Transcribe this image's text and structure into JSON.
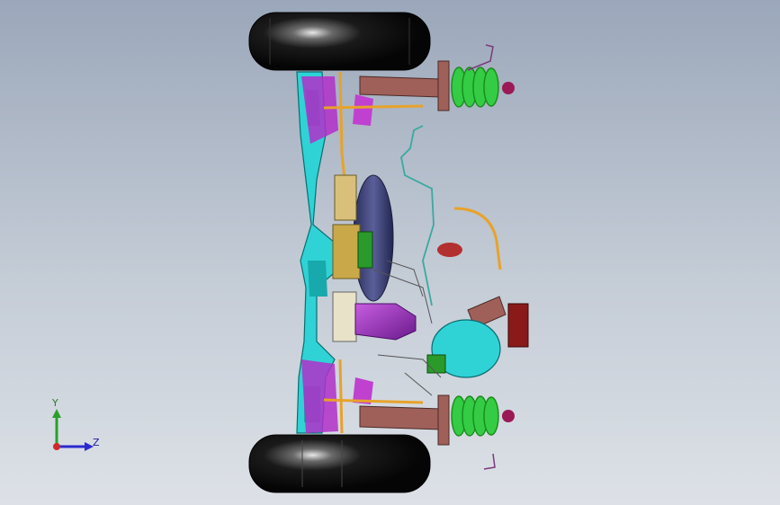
{
  "axis_triad": {
    "y_label": "Y",
    "z_label": "Z"
  },
  "colors": {
    "background_top": "#9ba7ba",
    "background_bottom": "#dde1e7",
    "tire": "#111111",
    "frame": "#2fd3d6",
    "coil_spring": "#33cc44",
    "catalytic_converter": "#9b2fc9",
    "fuel_tank": "#3a3f7a",
    "brake_line": "#e8a22a",
    "muffler": "#a0605a",
    "rear_component": "#8a1a1a"
  }
}
